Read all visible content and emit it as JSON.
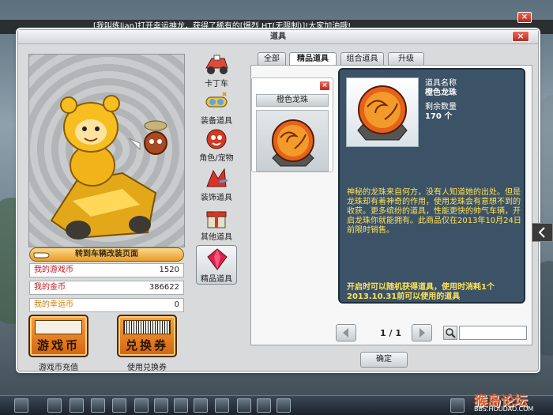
{
  "broadcast": "[我叫练lian]打开幸运神龙，获得了稀有的[爆烈 HT(无限制)]!大家加油哦!",
  "window": {
    "title": "道具",
    "close_label": "×"
  },
  "top_close_label": "×",
  "avatar": {
    "remodel_button": "转到车辆改装页面"
  },
  "stats": [
    {
      "label": "我的游戏币",
      "value": "1520"
    },
    {
      "label": "我的金币",
      "value": "386622"
    },
    {
      "label": "我的幸运币",
      "value": "0"
    }
  ],
  "big_buttons": [
    {
      "text": "游戏币",
      "caption": "游戏币充值"
    },
    {
      "text": "兑换券",
      "caption": "使用兑换券"
    }
  ],
  "categories": [
    {
      "label": "卡丁车",
      "icon": "kart-icon"
    },
    {
      "label": "装备道具",
      "icon": "goggles-icon"
    },
    {
      "label": "角色/宠物",
      "icon": "character-pet-icon"
    },
    {
      "label": "装饰道具",
      "icon": "decoration-icon"
    },
    {
      "label": "其他道具",
      "icon": "gift-box-icon"
    },
    {
      "label": "精品道具",
      "icon": "red-gem-icon",
      "active": true
    }
  ],
  "tabs": [
    {
      "label": "全部"
    },
    {
      "label": "精品道具",
      "active": true
    },
    {
      "label": "组合道具"
    },
    {
      "label": "升级"
    }
  ],
  "item_card": {
    "name": "橙色龙珠",
    "close_label": "×"
  },
  "detail": {
    "name_key": "道具名称",
    "name_value": "橙色龙珠",
    "qty_key": "剩余数量",
    "qty_value": "170 个",
    "description": "神秘的龙珠来自何方，没有人知道她的出处。但是龙珠却有着神奇的作用，使用龙珠会有意想不到的收获。更多缤纷的道具，性能更快的帅气车辆，开启龙珠你就能拥有。此商品仅在2013年10月24日前限时销售。",
    "effect": "开启时可以随机获得道具，使用时消耗1个2013.10.31前可以使用的道具"
  },
  "pager": {
    "text": "1 / 1"
  },
  "search": {
    "placeholder": ""
  },
  "ok_button": "确定",
  "watermark": {
    "main": "猴岛论坛",
    "sub": "BBS.HOUDAO.COM"
  },
  "colors": {
    "detail_bg": "#3c5266",
    "detail_text": "#ffe35a",
    "accent_orange": "#f08a24"
  }
}
